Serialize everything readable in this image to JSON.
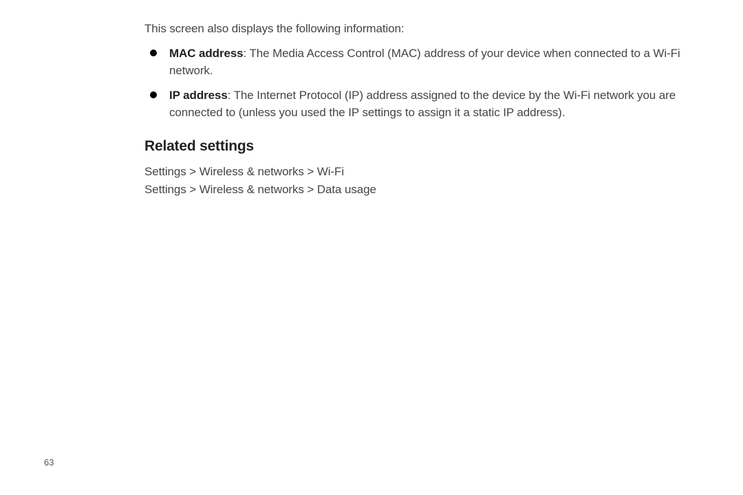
{
  "intro": "This screen also displays the following information:",
  "bullets": [
    {
      "term": "MAC address",
      "desc": ": The Media Access Control (MAC) address of your device when connected to a Wi-Fi network."
    },
    {
      "term": "IP address",
      "desc": ": The Internet Protocol (IP) address assigned to the device by the Wi-Fi network you are connected to (unless you used the IP settings to assign it a static IP address)."
    }
  ],
  "heading": "Related settings",
  "paths": [
    "Settings > Wireless & networks > Wi-Fi",
    "Settings > Wireless & networks > Data usage"
  ],
  "pageNumber": "63"
}
